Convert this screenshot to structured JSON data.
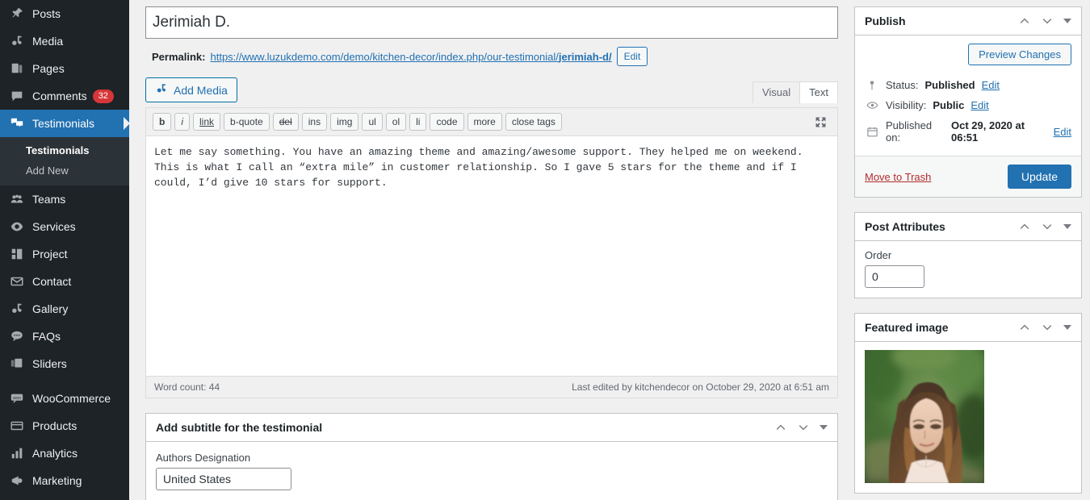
{
  "sidebar": {
    "items": [
      {
        "label": "Posts",
        "icon": "pin-icon",
        "current": false
      },
      {
        "label": "Media",
        "icon": "media-icon",
        "current": false
      },
      {
        "label": "Pages",
        "icon": "pages-icon",
        "current": false
      },
      {
        "label": "Comments",
        "icon": "comment-icon",
        "current": false,
        "badge": "32"
      },
      {
        "label": "Testimonials",
        "icon": "testimonials-icon",
        "current": true
      }
    ],
    "submenu": [
      {
        "label": "Testimonials",
        "active": true
      },
      {
        "label": "Add New",
        "active": false
      }
    ],
    "items2": [
      {
        "label": "Teams",
        "icon": "teams-icon"
      },
      {
        "label": "Services",
        "icon": "services-icon"
      },
      {
        "label": "Project",
        "icon": "project-icon"
      },
      {
        "label": "Contact",
        "icon": "envelope-icon"
      },
      {
        "label": "Gallery",
        "icon": "gallery-icon"
      },
      {
        "label": "FAQs",
        "icon": "faq-icon"
      },
      {
        "label": "Sliders",
        "icon": "sliders-icon"
      }
    ],
    "items3": [
      {
        "label": "WooCommerce",
        "icon": "woocommerce-icon"
      },
      {
        "label": "Products",
        "icon": "products-icon"
      },
      {
        "label": "Analytics",
        "icon": "analytics-icon"
      },
      {
        "label": "Marketing",
        "icon": "megaphone-icon"
      }
    ],
    "badge_color": "#d63638",
    "current_color": "#2271b1"
  },
  "post": {
    "title": "Jerimiah D.",
    "title_placeholder": "Add title",
    "permalink_label": "Permalink:",
    "permalink_base": "https://www.luzukdemo.com/demo/kitchen-decor/index.php/our-testimonial/",
    "permalink_slug": "jerimiah-d/",
    "permalink_edit_label": "Edit"
  },
  "editor": {
    "add_media_label": "Add Media",
    "tabs": [
      {
        "label": "Visual",
        "active": false
      },
      {
        "label": "Text",
        "active": true
      }
    ],
    "quicktags": [
      "b",
      "i",
      "link",
      "b-quote",
      "del",
      "ins",
      "img",
      "ul",
      "ol",
      "li",
      "code",
      "more",
      "close tags"
    ],
    "fullscreen_icon": "fullscreen-icon",
    "content": "Let me say something. You have an amazing theme and amazing/awesome support. They helped me on weekend. This is what I call an “extra mile” in customer relationship. So I gave 5 stars for the theme and if I could, I’d give 10 stars for support.",
    "word_count": "Word count: 44",
    "last_edited": "Last edited by kitchendecor on October 29, 2020 at 6:51 am"
  },
  "subtitle_box": {
    "title": "Add subtitle for the testimonial",
    "field_label": "Authors Designation",
    "field_value": "United States"
  },
  "publish": {
    "title": "Publish",
    "preview_label": "Preview Changes",
    "status_label": "Status:",
    "status_value": "Published",
    "status_edit": "Edit",
    "visibility_label": "Visibility:",
    "visibility_value": "Public",
    "visibility_edit": "Edit",
    "published_label": "Published on:",
    "published_value": "Oct 29, 2020 at 06:51",
    "published_edit": "Edit",
    "trash_label": "Move to Trash",
    "update_label": "Update",
    "update_color": "#2271b1",
    "trash_color": "#b32d2e"
  },
  "post_attributes": {
    "title": "Post Attributes",
    "order_label": "Order",
    "order_value": "0"
  },
  "featured_image": {
    "title": "Featured image",
    "alt": "portrait of a woman with long brown hair looking down, blurred green foliage background"
  }
}
